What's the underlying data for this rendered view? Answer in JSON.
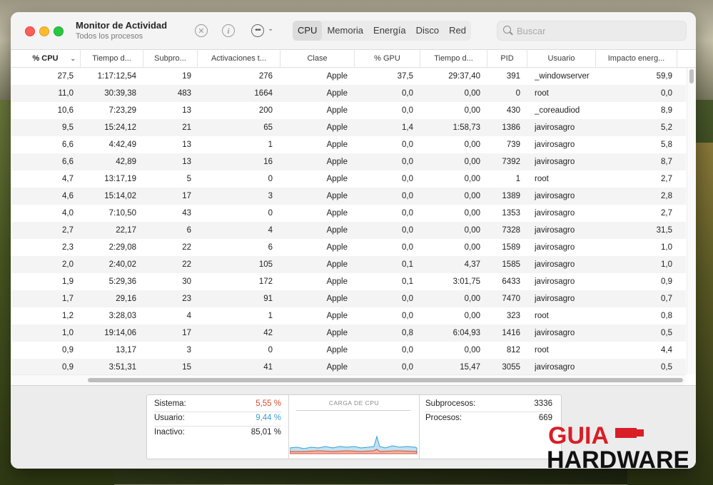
{
  "window": {
    "title": "Monitor de Actividad",
    "subtitle": "Todos los procesos"
  },
  "toolbar": {
    "icons": [
      "stop-process-icon",
      "info-icon",
      "more-options-icon",
      "chevron-down-icon"
    ],
    "tabs": [
      {
        "label": "CPU",
        "active": true
      },
      {
        "label": "Memoria",
        "active": false
      },
      {
        "label": "Energía",
        "active": false
      },
      {
        "label": "Disco",
        "active": false
      },
      {
        "label": "Red",
        "active": false
      }
    ],
    "search_placeholder": "Buscar"
  },
  "table": {
    "columns": [
      "% CPU",
      "Tiempo d...",
      "Subpro...",
      "Activaciones t...",
      "Clase",
      "% GPU",
      "Tiempo d...",
      "PID",
      "Usuario",
      "Impacto energ..."
    ],
    "sorted_column": "% CPU",
    "rows": [
      [
        "27,5",
        "1:17:12,54",
        "19",
        "276",
        "Apple",
        "37,5",
        "29:37,40",
        "391",
        "_windowserver",
        "59,9"
      ],
      [
        "11,0",
        "30:39,38",
        "483",
        "1664",
        "Apple",
        "0,0",
        "0,00",
        "0",
        "root",
        "0,0"
      ],
      [
        "10,6",
        "7:23,29",
        "13",
        "200",
        "Apple",
        "0,0",
        "0,00",
        "430",
        "_coreaudiod",
        "8,9"
      ],
      [
        "9,5",
        "15:24,12",
        "21",
        "65",
        "Apple",
        "1,4",
        "1:58,73",
        "1386",
        "javirosagro",
        "5,2"
      ],
      [
        "6,6",
        "4:42,49",
        "13",
        "1",
        "Apple",
        "0,0",
        "0,00",
        "739",
        "javirosagro",
        "5,8"
      ],
      [
        "6,6",
        "42,89",
        "13",
        "16",
        "Apple",
        "0,0",
        "0,00",
        "7392",
        "javirosagro",
        "8,7"
      ],
      [
        "4,7",
        "13:17,19",
        "5",
        "0",
        "Apple",
        "0,0",
        "0,00",
        "1",
        "root",
        "2,7"
      ],
      [
        "4,6",
        "15:14,02",
        "17",
        "3",
        "Apple",
        "0,0",
        "0,00",
        "1389",
        "javirosagro",
        "2,8"
      ],
      [
        "4,0",
        "7:10,50",
        "43",
        "0",
        "Apple",
        "0,0",
        "0,00",
        "1353",
        "javirosagro",
        "2,7"
      ],
      [
        "2,7",
        "22,17",
        "6",
        "4",
        "Apple",
        "0,0",
        "0,00",
        "7328",
        "javirosagro",
        "31,5"
      ],
      [
        "2,3",
        "2:29,08",
        "22",
        "6",
        "Apple",
        "0,0",
        "0,00",
        "1589",
        "javirosagro",
        "1,0"
      ],
      [
        "2,0",
        "2:40,02",
        "22",
        "105",
        "Apple",
        "0,1",
        "4,37",
        "1585",
        "javirosagro",
        "1,0"
      ],
      [
        "1,9",
        "5:29,36",
        "30",
        "172",
        "Apple",
        "0,1",
        "3:01,75",
        "6433",
        "javirosagro",
        "0,9"
      ],
      [
        "1,7",
        "29,16",
        "23",
        "91",
        "Apple",
        "0,0",
        "0,00",
        "7470",
        "javirosagro",
        "0,7"
      ],
      [
        "1,2",
        "3:28,03",
        "4",
        "1",
        "Apple",
        "0,0",
        "0,00",
        "323",
        "root",
        "0,8"
      ],
      [
        "1,0",
        "19:14,06",
        "17",
        "42",
        "Apple",
        "0,8",
        "6:04,93",
        "1416",
        "javirosagro",
        "0,5"
      ],
      [
        "0,9",
        "13,17",
        "3",
        "0",
        "Apple",
        "0,0",
        "0,00",
        "812",
        "root",
        "4,4"
      ],
      [
        "0,9",
        "3:51,31",
        "15",
        "41",
        "Apple",
        "0,0",
        "15,47",
        "3055",
        "javirosagro",
        "0,5"
      ]
    ]
  },
  "summary": {
    "left": [
      {
        "label": "Sistema:",
        "value": "5,55 %",
        "color": "#d64b2e"
      },
      {
        "label": "Usuario:",
        "value": "9,44 %",
        "color": "#3a9fd0"
      },
      {
        "label": "Inactivo:",
        "value": "85,01 %",
        "color": "#1f1f1f"
      }
    ],
    "chart_title": "CARGA DE CPU",
    "right": [
      {
        "label": "Subprocesos:",
        "value": "3336"
      },
      {
        "label": "Procesos:",
        "value": "669"
      }
    ]
  },
  "watermark": {
    "line1": "GUIA",
    "line2": "HARDWARE"
  },
  "colors": {
    "system_line": "#d64b2e",
    "user_line": "#3a9fd0",
    "logo_red": "#d81e27",
    "logo_black": "#111111"
  }
}
